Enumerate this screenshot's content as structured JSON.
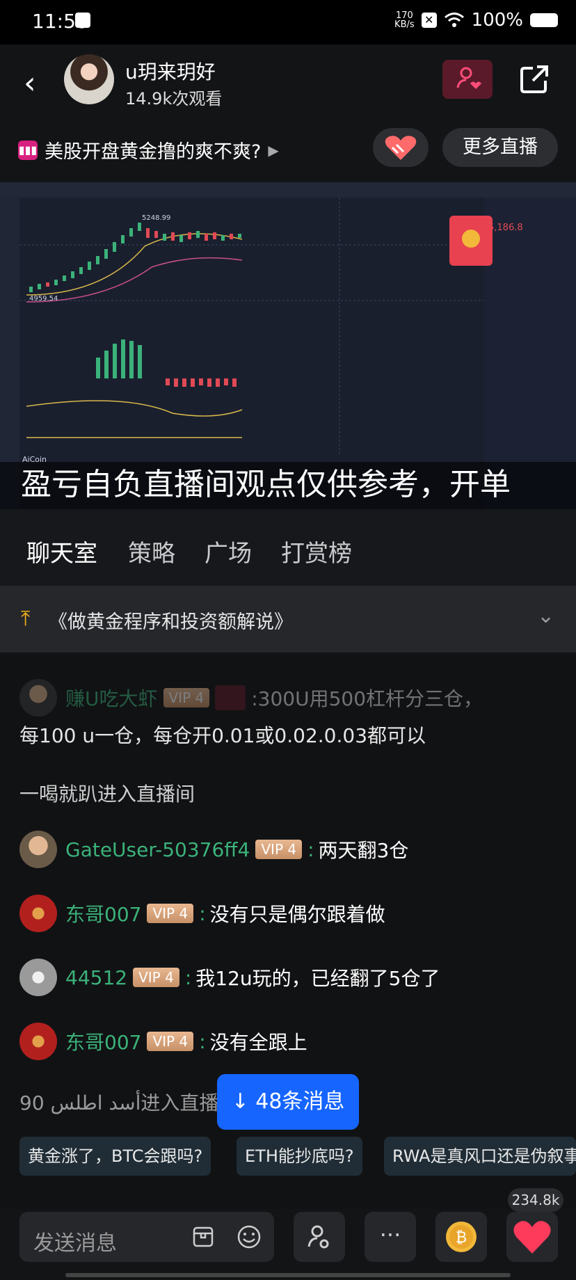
{
  "status_bar": {
    "time": "11:58",
    "net_speed_value": "170",
    "net_speed_unit": "KB/s",
    "battery": "100%"
  },
  "header": {
    "host_name": "u玥来玥好",
    "views": "14.9k次观看"
  },
  "topic": {
    "title": "美股开盘黄金撸的爽不爽?",
    "more_live": "更多直播"
  },
  "video": {
    "overlay_text": "盈亏自负直播间观点仅供参考，开单",
    "watermark": "AiCoin",
    "chart_label_high": "5248.99",
    "chart_label_low": "4959.54",
    "side_price": "5,186.8"
  },
  "tabs": [
    "聊天室",
    "策略",
    "广场",
    "打赏榜"
  ],
  "pinned": {
    "text": "《做黄金程序和投资额解说》"
  },
  "chat": {
    "messages": [
      {
        "user": "赚U吃大虾",
        "vip": "VIP 4",
        "text": ":300U用500杠杆分三仓，",
        "text2": "每100 u一仓，每仓开0.01或0.02.0.03都可以"
      },
      {
        "system": "一喝就趴进入直播间"
      },
      {
        "user": "GateUser-50376ff4",
        "vip": "VIP 4",
        "text": "两天翻3仓"
      },
      {
        "user": "东哥007",
        "vip": "VIP 4",
        "text": "没有只是偶尔跟着做"
      },
      {
        "user": "44512",
        "vip": "VIP 4",
        "text": "我12u玩的，已经翻了5仓了"
      },
      {
        "user": "东哥007",
        "vip": "VIP 4",
        "text": "没有全跟上"
      },
      {
        "system": "90 أسد اطلس进入直播"
      }
    ],
    "new_messages": "↓ 48条消息",
    "quick_replies": [
      "黄金涨了，BTC会跟吗?",
      "ETH能抄底吗?",
      "RWA是真风口还是伪叙事"
    ],
    "likes": "234.8k"
  },
  "bottom_bar": {
    "input_placeholder": "发送消息"
  },
  "colors": {
    "accent_green": "#3bb27a",
    "vip_gold": "#d9a47c",
    "new_msg_blue": "#1665ff",
    "heart_red": "#ff3b5c"
  }
}
